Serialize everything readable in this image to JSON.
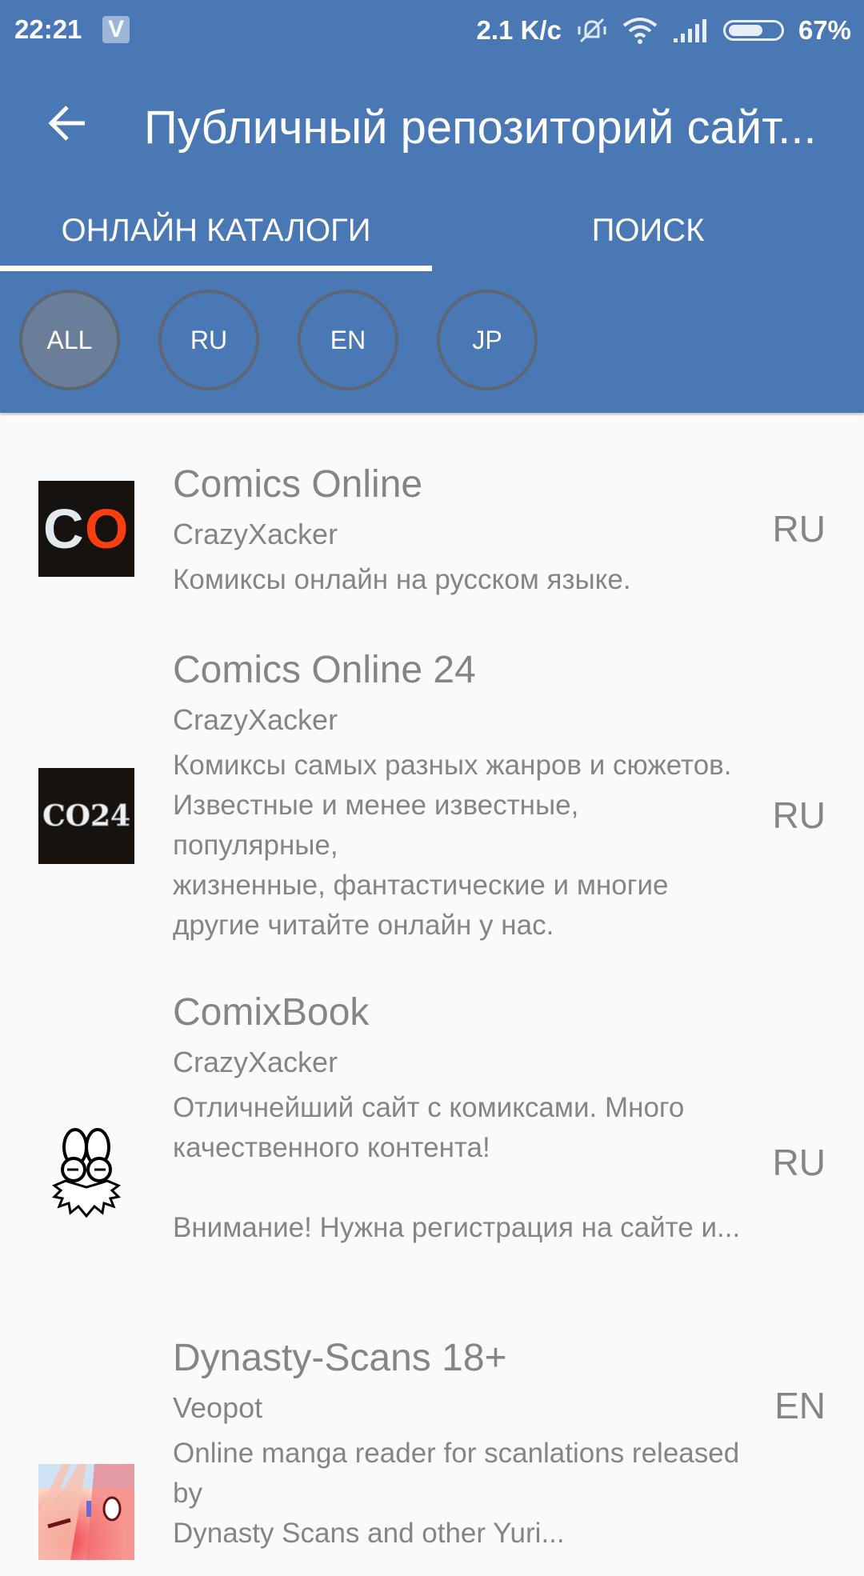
{
  "status_bar": {
    "time": "22:21",
    "app_badge": "V",
    "net_speed": "2.1 K/c",
    "battery_percent_label": "67%",
    "battery_level": 0.67
  },
  "app_bar": {
    "title": "Публичный репозиторий сайт...",
    "back_icon": "arrow-left-icon"
  },
  "tabs": [
    {
      "label": "ОНЛАЙН КАТАЛОГИ",
      "active": true
    },
    {
      "label": "ПОИСК",
      "active": false
    }
  ],
  "filters": [
    {
      "label": "ALL",
      "active": true
    },
    {
      "label": "RU",
      "active": false
    },
    {
      "label": "EN",
      "active": false
    },
    {
      "label": "JP",
      "active": false
    }
  ],
  "catalogs": [
    {
      "name": "Comics Online",
      "author": "CrazyXacker",
      "description": "Комиксы онлайн на русском языке.",
      "lang": "RU",
      "icon": "co-logo-icon"
    },
    {
      "name": "Comics Online 24",
      "author": "CrazyXacker",
      "description": "Комиксы самых разных жанров и сюжетов.\nИзвестные и менее известные, популярные,\nжизненные, фантастические и многие\nдругие читайте онлайн у нас.",
      "lang": "RU",
      "icon": "co24-logo-icon"
    },
    {
      "name": "ComixBook",
      "author": "CrazyXacker",
      "description": "Отличнейший сайт с комиксами. Много\nкачественного контента!\n\nВнимание! Нужна регистрация на сайте и...",
      "lang": "RU",
      "icon": "comixbook-logo-icon"
    },
    {
      "name": "Dynasty-Scans 18+",
      "author": "Veopot",
      "description": "Online manga reader for scanlations released by\nDynasty Scans and other Yuri...",
      "lang": "EN",
      "icon": "dynasty-scans-logo-icon"
    }
  ]
}
